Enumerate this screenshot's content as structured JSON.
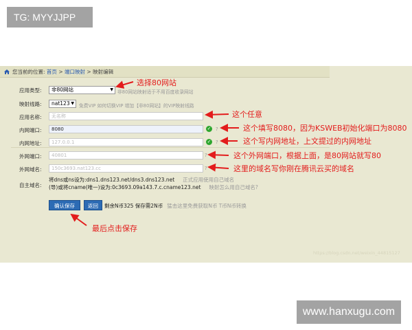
{
  "top_label": "TG: MYYJJPP",
  "breadcrumb": {
    "prefix": "您当前的位置:",
    "home": "首页",
    "arrow1": ">",
    "port_mapping": "端口映射",
    "arrow2": ">",
    "current": "映射编辑"
  },
  "form": {
    "app_type": {
      "label": "应用类型:",
      "value": "非80网站",
      "hint": "非80网站映射适于不用百度收录网站"
    },
    "line": {
      "label": "映射线路:",
      "value": "nat123",
      "hint": "免费VIP  如何切换VIP  增加【非80网站】的VIP映射线路"
    },
    "app_name": {
      "label": "应用名称:",
      "placeholder": "无名称"
    },
    "inner_port": {
      "label": "内网端口:",
      "value": "8080"
    },
    "inner_addr": {
      "label": "内网地址:",
      "value": "127.0.0.1"
    },
    "outer_port": {
      "label": "外网端口:",
      "value": "40801"
    },
    "outer_domain": {
      "label": "外网域名:",
      "value": "150c3693.nat123.cc"
    },
    "custom_domain": {
      "label": "自主域名:",
      "line1": "将dns或ns设为:dns1.dns123.net/dns3.dns123.net",
      "line1_hint": "正式应用使用自己域名",
      "line2": "(导)或将cname(唯一)设为:0c3693.09a143.7.c.cname123.net",
      "line2_hint": "映射怎么用自己域名?"
    }
  },
  "buttons": {
    "save": "确认保存",
    "back": "返回"
  },
  "balance": {
    "text": "剩余N币325 保存需2N币",
    "hint": "猛击这里免费获取N币 T币N币转换"
  },
  "annotations": {
    "a1": "选择80网站",
    "a2": "这个任意",
    "a3": "这个填写8080，因为KSWEB初始化端口为8080",
    "a4": "这个写内网地址，上文提过的内网地址",
    "a5": "这个外网端口，根据上面，是80网站就写80",
    "a6": "这里的域名写你刚在腾讯云买的域名",
    "a7": "最后点击保存"
  },
  "inner_watermark": "https://blog.csdn.net/weixin_44815127",
  "watermark": "www.hanxugu.com",
  "colors": {
    "panel": "#e9e8d2",
    "annotation": "#e31c1c",
    "button": "#2c6bb4",
    "check": "#2ea62e"
  }
}
